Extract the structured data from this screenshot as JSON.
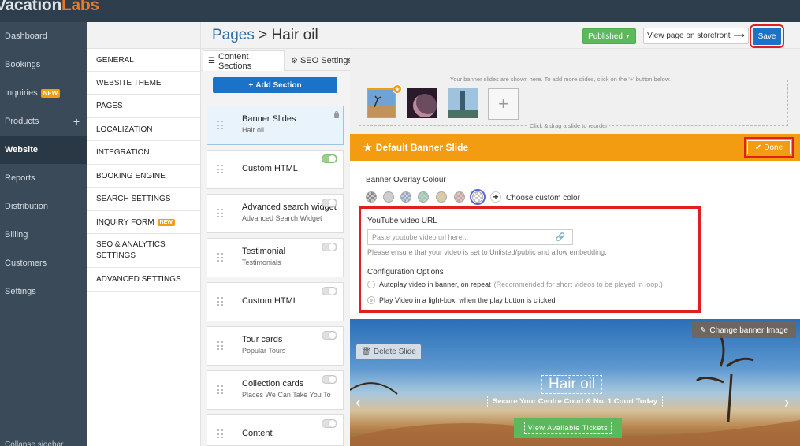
{
  "app": {
    "brand_main": "Vacation",
    "brand_accent": "Labs"
  },
  "nav": [
    {
      "label": "Dashboard"
    },
    {
      "label": "Bookings"
    },
    {
      "label": "Inquiries",
      "badge": "NEW"
    },
    {
      "label": "Products",
      "extra": "+"
    },
    {
      "label": "Website",
      "active": true
    },
    {
      "label": "Reports"
    },
    {
      "label": "Distribution"
    },
    {
      "label": "Billing"
    },
    {
      "label": "Customers"
    },
    {
      "label": "Settings"
    }
  ],
  "nav_collapse_label": "Collapse sidebar",
  "settings_menu": [
    "GENERAL",
    "WEBSITE THEME",
    "PAGES",
    "LOCALIZATION",
    "INTEGRATION",
    "BOOKING ENGINE",
    "SEARCH SETTINGS",
    "INQUIRY FORM",
    "SEO & ANALYTICS SETTINGS",
    "ADVANCED SETTINGS"
  ],
  "settings_new_badge": "NEW",
  "header": {
    "breadcrumb_root": "Pages",
    "breadcrumb_sep": ">",
    "breadcrumb_current": "Hair oil",
    "published_label": "Published",
    "storefront_label": "View page on storefront",
    "save_label": "Save"
  },
  "tabs": {
    "content": "Content Sections",
    "seo": "SEO Settings"
  },
  "add_section_label": "Add Section",
  "sections": [
    {
      "title": "Banner Slides",
      "subtitle": "Hair oil",
      "state": "locked"
    },
    {
      "title": "Custom HTML",
      "subtitle": "",
      "state": "on"
    },
    {
      "title": "Advanced search widget",
      "subtitle": "Advanced Search Widget",
      "state": "off"
    },
    {
      "title": "Testimonial",
      "subtitle": "Testimonials",
      "state": "off"
    },
    {
      "title": "Custom HTML",
      "subtitle": "",
      "state": "off"
    },
    {
      "title": "Tour cards",
      "subtitle": "Popular Tours",
      "state": "off"
    },
    {
      "title": "Collection cards",
      "subtitle": "Places We Can Take You To",
      "state": "off"
    },
    {
      "title": "Content",
      "subtitle": "",
      "state": "off"
    }
  ],
  "slides": {
    "hint_top": "Your banner slides are shown here. To add more slides, click on the '+' button below.",
    "hint_bottom": "Click & drag a slide to reorder",
    "add_glyph": "+"
  },
  "slide_editor": {
    "title": "Default Banner Slide",
    "done_label": "Done",
    "overlay_label": "Banner Overlay Colour",
    "custom_color_label": "Choose custom color",
    "swatch_colors": [
      "#888888",
      "#cfcfcf",
      "#8fa8d6",
      "#8fd0b0",
      "#e6c98a",
      "#d8a0a0",
      "#ffffff"
    ],
    "youtube_label": "YouTube video URL",
    "youtube_placeholder": "Paste youtube video url here...",
    "youtube_note": "Please ensure that your video is set to Unlisted/public and allow embedding.",
    "config_label": "Configuration Options",
    "option1": "Autoplay video in banner, on repeat",
    "option1_note": "(Recommended for short videos to be played in loop.)",
    "option2": "Play Video in a light-box, when the play button is clicked"
  },
  "banner": {
    "change_image_label": "Change banner Image",
    "delete_label": "Delete Slide",
    "title": "Hair oil",
    "subtitle": "Secure Your Centre Court & No. 1 Court Today",
    "cta": "View Available Tickets"
  },
  "colors": {
    "accent": "#f39c12",
    "primary": "#1a73c9",
    "success": "#5cb85c",
    "highlight": "#e02020"
  }
}
